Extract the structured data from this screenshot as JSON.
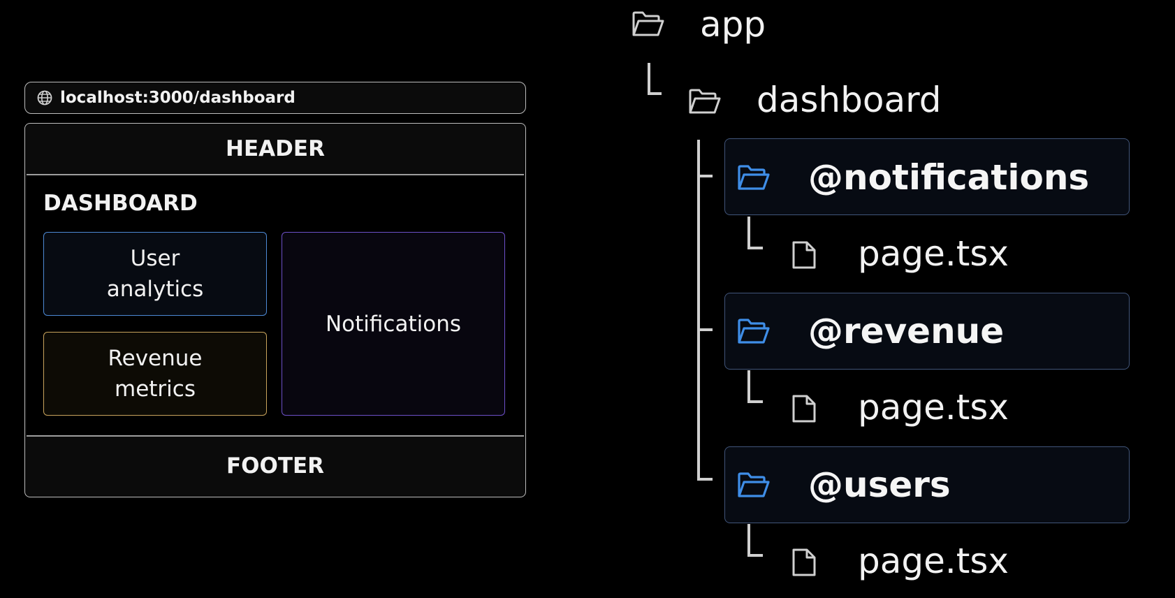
{
  "browser": {
    "url": "localhost:3000/dashboard",
    "icon": "globe-icon"
  },
  "layout_preview": {
    "header": "HEADER",
    "dashboard_title": "DASHBOARD",
    "cards": {
      "user_analytics": "User analytics",
      "revenue_metrics": "Revenue metrics",
      "notifications": "Notifications"
    },
    "footer": "FOOTER"
  },
  "file_tree": {
    "root": {
      "name": "app",
      "icon": "folder-icon"
    },
    "dashboard": {
      "name": "dashboard",
      "icon": "folder-icon"
    },
    "slots": [
      {
        "name": "@notifications",
        "icon": "folder-icon",
        "file": "page.tsx"
      },
      {
        "name": "@revenue",
        "icon": "folder-icon",
        "file": "page.tsx"
      },
      {
        "name": "@users",
        "icon": "folder-icon",
        "file": "page.tsx"
      }
    ]
  },
  "colors": {
    "background": "#000000",
    "user_analytics_border": "#4d8ad6",
    "revenue_metrics_border": "#c9a45c",
    "notifications_border": "#6d50c9",
    "slot_folder_icon": "#3f8ee8",
    "slot_box_border": "#41557a"
  }
}
